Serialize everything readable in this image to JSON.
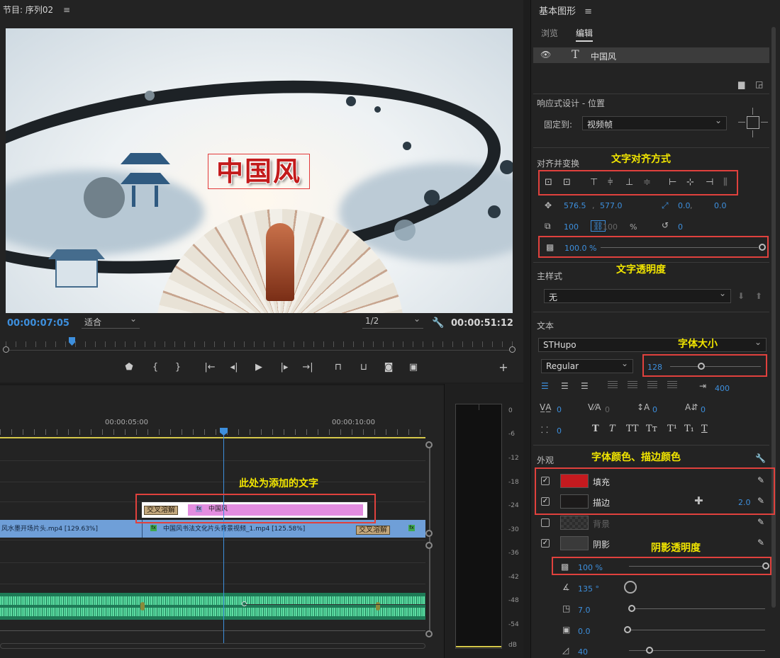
{
  "program_monitor": {
    "title": "节目: 序列02",
    "menu_glyph": "≡",
    "preview_overlay_text": "中国风",
    "timecode_current": "00:00:07:05",
    "fit_value": "适合",
    "resolution_value": "1/2",
    "timecode_total": "00:00:51:12",
    "transport_glyphs": {
      "marker": "⬟",
      "in": "{",
      "out": "}",
      "go_in": "|←",
      "step_back": "◂|",
      "play": "▶",
      "step_fwd": "|▸",
      "go_out": "→|",
      "lift": "⊓",
      "extract": "⊔",
      "export_frame": "◙",
      "compare": "▣",
      "add": "+"
    }
  },
  "timeline": {
    "ruler_labels": [
      "00:00:05:00",
      "00:00:10:00"
    ],
    "video_clip_1": "风水墨开场片头.mp4 [129.63%]",
    "video_clip_2": "中国风书法文化片头背景视频_1.mp4 [125.58%]",
    "title_clip_label": "中国风",
    "transition_label": "交叉溶解",
    "fx_label": "fx"
  },
  "audio_meter": {
    "scale": [
      "0",
      "-6",
      "-12",
      "-18",
      "-24",
      "-30",
      "-36",
      "-42",
      "-48",
      "-54",
      "dB"
    ]
  },
  "essential_graphics": {
    "header": "基本图形",
    "menu_glyph": "≡",
    "tabs": {
      "browse": "浏览",
      "edit": "编辑"
    },
    "layer": {
      "icon": "T",
      "name": "中国风"
    },
    "responsive": {
      "label": "响应式设计 - 位置",
      "pin_label": "固定到:",
      "pin_value": "视频帧"
    },
    "align": {
      "label": "对齐并变换",
      "position_x": "576.5",
      "position_y": "577.0",
      "anchor_x": "0.0",
      "anchor_y": "0.0",
      "scale": "100",
      "scale_linked": "100",
      "percent": "%",
      "rotation": "0",
      "opacity": "100.0 %"
    },
    "master_style": {
      "label": "主样式",
      "value": "无"
    },
    "text": {
      "label": "文本",
      "font": "STHupo",
      "style": "Regular",
      "size": "128",
      "size_fraction": 0.33,
      "leading": "400",
      "tracking": "0",
      "kerning": "0",
      "baseline": "0",
      "tsume": "0",
      "indent": "0",
      "style_buttons": [
        "T",
        "T",
        "TT",
        "Tт",
        "T¹",
        "T₁",
        "T"
      ]
    },
    "appearance": {
      "label": "外观",
      "fill": {
        "label": "填充",
        "color": "#c41a1f",
        "checked": true
      },
      "stroke": {
        "label": "描边",
        "color": "#1c1a1a",
        "checked": true,
        "width": "2.0"
      },
      "background": {
        "label": "背景",
        "checked": false
      },
      "shadow": {
        "label": "阴影",
        "checked": true,
        "opacity": "100 %",
        "angle": "135 °",
        "distance": "7.0",
        "size": "0.0",
        "blur": "40"
      }
    }
  },
  "annotations": {
    "text_align": "文字对齐方式",
    "text_opacity": "文字透明度",
    "font_size": "字体大小",
    "font_colors": "字体颜色、描边颜色",
    "shadow_opacity": "阴影透明度",
    "added_text": "此处为添加的文字"
  },
  "colors": {
    "accent_blue": "#3d8fdd",
    "annotation_red": "#e0413d",
    "annotation_yellow": "#f2e600",
    "title_red": "#c31b1b",
    "title_clip_pink": "#e38de0",
    "video_clip_blue": "#6f9fd8",
    "audio_green": "#1e7a56"
  }
}
